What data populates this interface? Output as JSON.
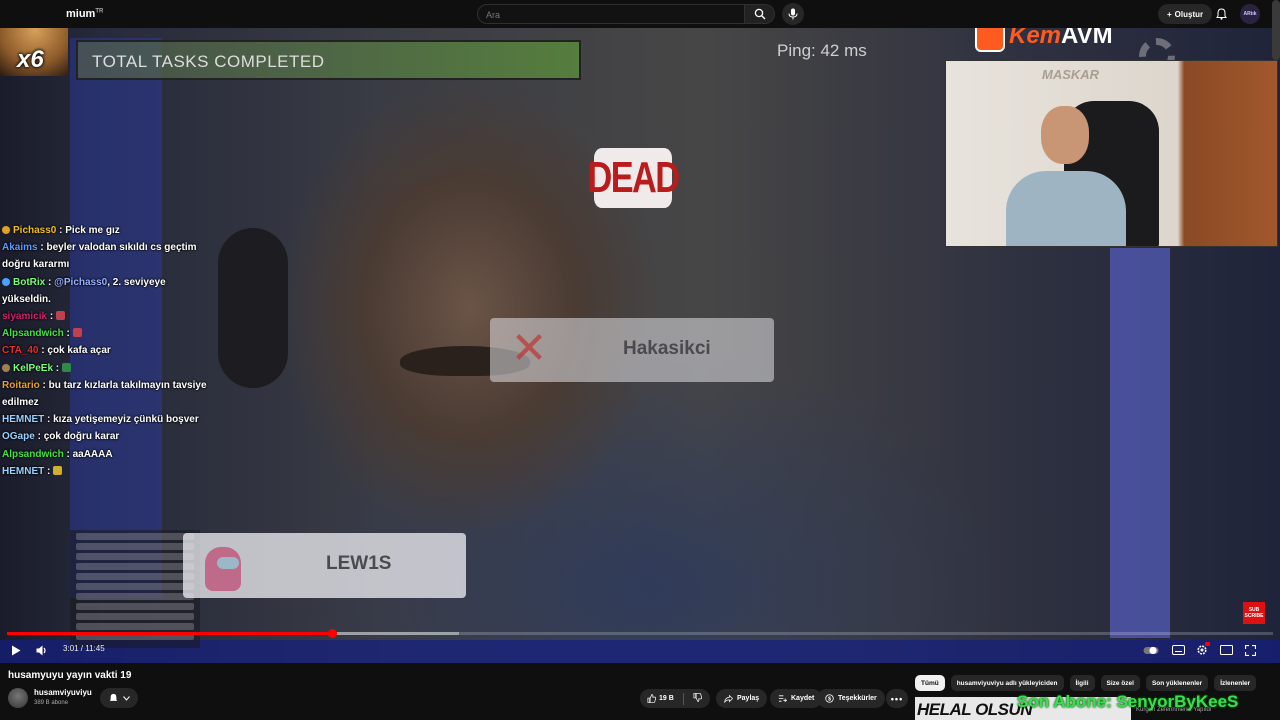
{
  "header": {
    "logo_text": "mium",
    "logo_sup": "TR",
    "search_placeholder": "Ara",
    "create_label": "Oluştur",
    "avatar_text": "ARtık"
  },
  "overlay": {
    "x6_label": "x6",
    "total_tasks": "TOTAL TASKS COMPLETED",
    "ping": "Ping: 42 ms",
    "dead_label": "DEAD",
    "player_dead": "Hakasikci",
    "player_lewis": "LEW1S",
    "facecam_sign": "MASKAR",
    "sponsor_a": "Kem",
    "sponsor_b": "AVM",
    "sub_badge": "SUB SCRIBE",
    "son_abone": "Son Abone: SenyorByKeeS"
  },
  "chat": [
    {
      "user": "Pichass0",
      "color": "#f0c020",
      "text": "Pick me gız",
      "badge": "#e0a020"
    },
    {
      "user": "Akaims",
      "color": "#5a9aff",
      "text": "beyler valodan sıkıldı cs geçtim doğru kararmı"
    },
    {
      "user": "BotRix",
      "color": "#7cfc7c",
      "text": "@Pichass0, 2. seviyeye yükseldin.",
      "mention": "@Pichass0",
      "after": ", 2. seviyeye yükseldin.",
      "badge": "#4aa0ff"
    },
    {
      "user": "siyamicik",
      "color": "#d0206a",
      "text": "",
      "emote": "#c04050"
    },
    {
      "user": "Alpsandwich",
      "color": "#46e046",
      "text": "",
      "emote": "#c04050"
    },
    {
      "user": "CTA_40",
      "color": "#e03030",
      "text": "çok kafa açar"
    },
    {
      "user": "KelPeEk",
      "color": "#7cfc7c",
      "text": "",
      "emote": "#2e8a4a",
      "badge": "#a08050"
    },
    {
      "user": "Roitario",
      "color": "#e8a030",
      "text": "bu tarz kızlarla takılmayın tavsiye edilmez"
    },
    {
      "user": "HEMNET",
      "color": "#9ad0ff",
      "text": "kıza yetişemeyiz çünkü boşver"
    },
    {
      "user": "OGape",
      "color": "#9ad0ff",
      "text": "çok doğru karar"
    },
    {
      "user": "Alpsandwich",
      "color": "#46e046",
      "text": "aaAAAA"
    },
    {
      "user": "HEMNET",
      "color": "#9ad0ff",
      "text": "",
      "emote": "#d0b030"
    }
  ],
  "player": {
    "time_current": "3:01",
    "time_total": "11:45",
    "time_display": "3:01 / 11:45",
    "progress_played_fraction": 0.257,
    "progress_buffered_fraction": 0.357
  },
  "video": {
    "title": "husamyuyu yayın vakti 19",
    "channel": "husamviyuviyu",
    "subscribers": "389 B abone",
    "likes": "19 B",
    "share_label": "Paylaş",
    "save_label": "Kaydet",
    "thanks_label": "Teşekkürler"
  },
  "recommendations": {
    "chips": [
      "Tümü",
      "husamviyuviyu adlı yükleyiciden",
      "İlgili",
      "Size özel",
      "Son yüklenenler",
      "İzlenenler"
    ],
    "active_chip": 0,
    "first_thumb_text": "HELAL OLSUN",
    "first_meta": "Kurgun Zeferinmeniz Yapıldı"
  },
  "colors": {
    "accent_red": "#ff0000",
    "bg": "#0f0f0f"
  }
}
